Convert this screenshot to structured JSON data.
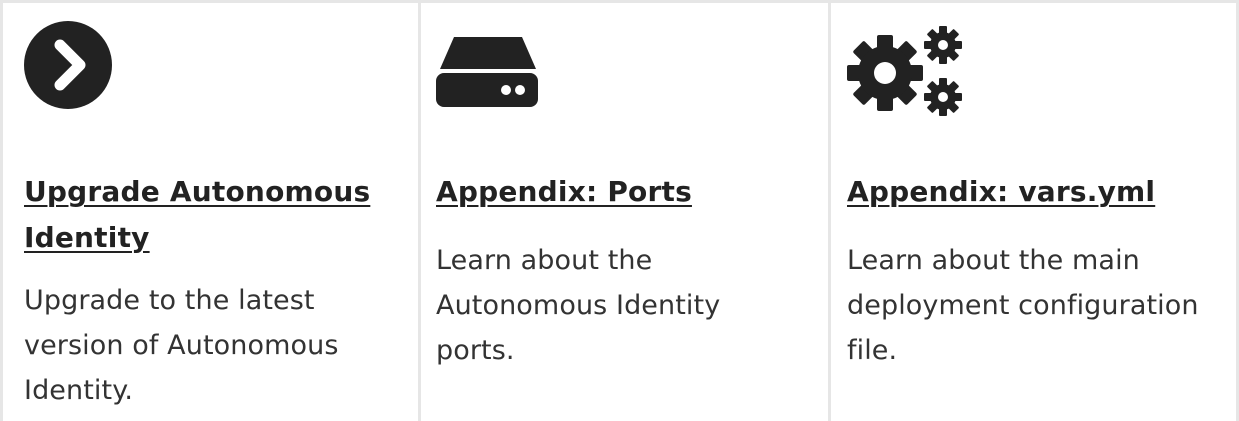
{
  "cards": [
    {
      "icon": "chevron-circle-right-icon",
      "title": "Upgrade Autonomous Identity",
      "description": "Upgrade to the latest version of Autonomous Identity."
    },
    {
      "icon": "server-drive-icon",
      "title": "Appendix: Ports",
      "description": "Learn about the Autonomous Identity ports."
    },
    {
      "icon": "gears-icon",
      "title": "Appendix: vars.yml",
      "description": "Learn about the main deployment configuration file."
    }
  ],
  "colors": {
    "icon": "#222222",
    "border": "#e6e6e6",
    "text": "#333333"
  }
}
